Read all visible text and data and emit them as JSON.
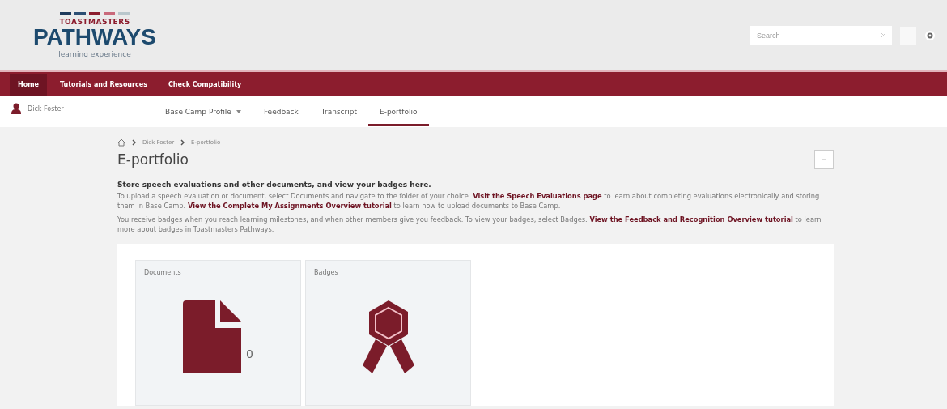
{
  "logo": {
    "top": "TOASTMASTERS",
    "name": "PATHWAYS",
    "tagline": "learning experience"
  },
  "search": {
    "placeholder": "Search"
  },
  "nav": [
    {
      "label": "Home",
      "selected": true
    },
    {
      "label": "Tutorials and Resources",
      "selected": false
    },
    {
      "label": "Check Compatibility",
      "selected": false
    }
  ],
  "user": {
    "name": "Dick Foster"
  },
  "tabs": [
    {
      "label": "Base Camp Profile",
      "selected": false,
      "dropdown": true
    },
    {
      "label": "Feedback",
      "selected": false,
      "dropdown": false
    },
    {
      "label": "Transcript",
      "selected": false,
      "dropdown": false
    },
    {
      "label": "E-portfolio",
      "selected": true,
      "dropdown": false
    }
  ],
  "breadcrumb": [
    "Dick Foster",
    "E-portfolio"
  ],
  "title": "E-portfolio",
  "collapse": "−",
  "intro": "Store speech evaluations and other documents, and view your badges here.",
  "paragraphs": [
    [
      {
        "text": "To upload a speech evaluation or document, select Documents and navigate to the folder of your choice. ",
        "link": false
      },
      {
        "text": "Visit the Speech Evaluations page",
        "link": true
      },
      {
        "text": " to learn about completing evaluations electronically and storing them in Base Camp. ",
        "link": false
      },
      {
        "text": "View the Complete My Assignments Overview tutorial",
        "link": true
      },
      {
        "text": " to learn how to upload documents to Base Camp.",
        "link": false
      }
    ],
    [
      {
        "text": "You receive badges when you reach learning milestones, and when other members give you feedback. To view your badges, select Badges. ",
        "link": false
      },
      {
        "text": "View the Feedback and Recognition Overview tutorial",
        "link": true
      },
      {
        "text": " to learn more about badges in Toastmasters Pathways.",
        "link": false
      }
    ]
  ],
  "cards": [
    {
      "kind": "documents",
      "title": "Documents",
      "count": "0"
    },
    {
      "kind": "badges",
      "title": "Badges"
    }
  ]
}
